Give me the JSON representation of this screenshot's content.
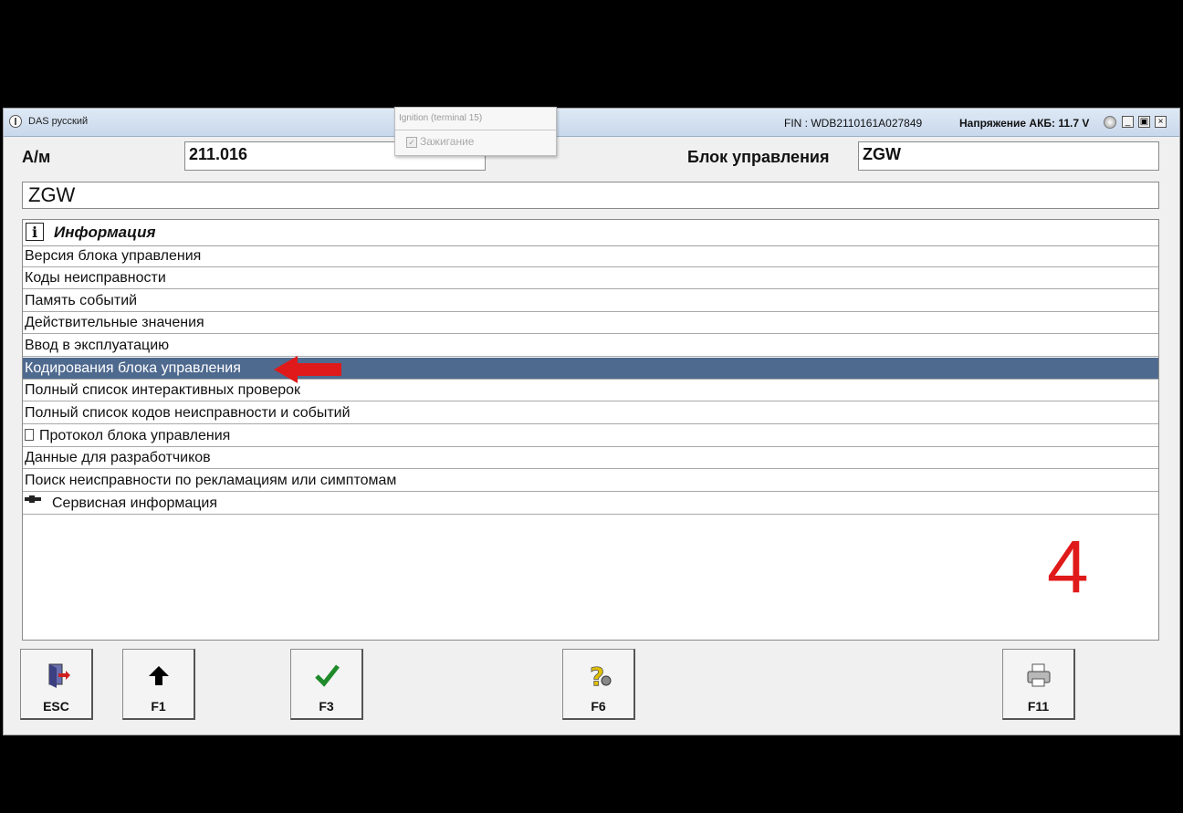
{
  "window": {
    "title": "DAS русский",
    "fin": "FIN : WDB2110161A027849",
    "battery_voltage": "Напряжение АКБ: 11.7 V",
    "minimize": "_",
    "restore": "▣",
    "close": "×"
  },
  "popup": {
    "title": "Ignition (terminal 15)",
    "checkbox_label": "Зажигание",
    "check_mark": "✓"
  },
  "vehicle": {
    "label": "А/м",
    "value": "211.016"
  },
  "control_unit": {
    "label": "Блок управления",
    "value": "ZGW"
  },
  "ecu_name": "ZGW",
  "menu": {
    "header_icon": "i",
    "header": "Информация",
    "items": [
      {
        "label": "Версия блока управления"
      },
      {
        "label": "Коды неисправности"
      },
      {
        "label": "Память событий"
      },
      {
        "label": "Действительные значения"
      },
      {
        "label": "Ввод в эксплуатацию"
      },
      {
        "label": "Кодирования блока управления",
        "selected": true
      },
      {
        "label": "Полный список интерактивных проверок"
      },
      {
        "label": "Полный список кодов неисправности и событий"
      },
      {
        "label": "Протокол блока управления",
        "icon": "document-icon"
      },
      {
        "label": "Данные для разработчиков"
      },
      {
        "label": "Поиск неисправности по рекламациям или симптомам"
      },
      {
        "label": "Сервисная информация",
        "icon": "pointing-hand-icon"
      }
    ]
  },
  "annotation": {
    "step_number": "4",
    "color": "#e01a1a"
  },
  "function_keys": [
    {
      "label": "ESC",
      "icon": "exit-door-icon"
    },
    {
      "label": "F1",
      "icon": "up-arrow-icon"
    },
    {
      "label": "F3",
      "icon": "checkmark-icon"
    },
    {
      "label": "F6",
      "icon": "help-question-icon"
    },
    {
      "label": "F11",
      "icon": "printer-icon"
    }
  ],
  "colors": {
    "selection": "#4f6a8f",
    "titlebar": "#c8d8ec"
  }
}
